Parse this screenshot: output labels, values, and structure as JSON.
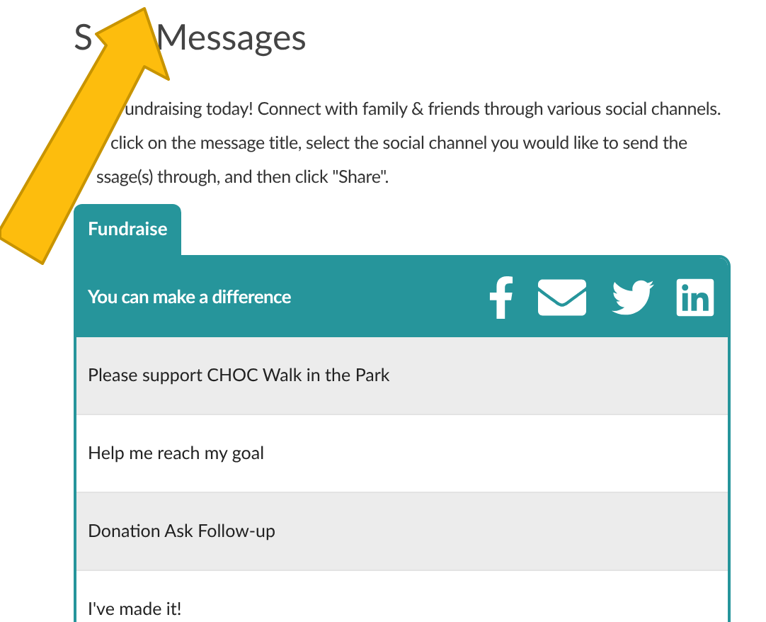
{
  "title_parts": [
    "S",
    "Messages"
  ],
  "intro_lines": [
    "undraising today! Connect with family & friends through various social channels.",
    "click on the message title, select the social channel you would like to send the",
    "ssage(s) through, and then click \"Share\"."
  ],
  "tabs": [
    {
      "label": "Fundraise",
      "selected": true
    }
  ],
  "panel": {
    "heading": "You can make a difference",
    "share_icons": [
      {
        "kind": "letter-f"
      },
      {
        "kind": "envelope"
      },
      {
        "kind": "bird"
      },
      {
        "kind": "in-logo"
      }
    ]
  },
  "messages": [
    {
      "title": "Please support CHOC Walk in the Park"
    },
    {
      "title": "Help me reach my goal"
    },
    {
      "title": "Donation Ask Follow-up"
    },
    {
      "title": "I've made it!"
    }
  ]
}
